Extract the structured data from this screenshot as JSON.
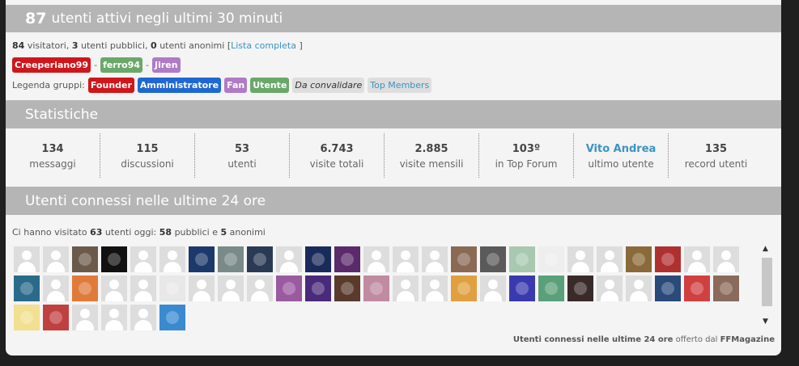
{
  "online": {
    "count": "87",
    "title": "utenti attivi negli ultimi 30 minuti",
    "visitors": "84",
    "visitors_label": "visitatori,",
    "public": "3",
    "public_label": "utenti pubblici,",
    "anon": "0",
    "anon_label": "utenti anonimi [",
    "full_list": "Lista completa",
    "close_bracket": "]",
    "users": [
      "Creeperiano99",
      "ferro94",
      "Jiren"
    ],
    "separator": "-",
    "legend_label": "Legenda gruppi:",
    "groups": [
      "Founder",
      "Amministratore",
      "Fan",
      "Utente",
      "Da convalidare",
      "Top Members"
    ]
  },
  "stats": {
    "title": "Statistiche",
    "items": [
      {
        "value": "134",
        "label": "messaggi"
      },
      {
        "value": "115",
        "label": "discussioni"
      },
      {
        "value": "53",
        "label": "utenti"
      },
      {
        "value": "6.743",
        "label": "visite totali"
      },
      {
        "value": "2.885",
        "label": "visite mensili"
      },
      {
        "value": "103º",
        "label": "in Top Forum"
      },
      {
        "value": "Vito Andrea",
        "label": "ultimo utente"
      },
      {
        "value": "135",
        "label": "record utenti"
      }
    ]
  },
  "last24": {
    "title": "Utenti connessi nelle ultime 24 ore",
    "visited_prefix": "Ci hanno visitato",
    "visited_count": "63",
    "visited_mid": "utenti oggi:",
    "public": "58",
    "public_label": "pubblici e",
    "anon": "5",
    "anon_label": "anonimi",
    "footer_bold": "Utenti connessi nelle ultime 24 ore",
    "footer_mid": "offerto dal",
    "footer_brand": "FFMagazine"
  },
  "colors": {
    "accent_link": "#3a93c4",
    "header_bg": "#b5b5b5",
    "founder": "#d0161b",
    "admin": "#1f68d2",
    "fan": "#b07ac6",
    "utente": "#6aa86a"
  }
}
